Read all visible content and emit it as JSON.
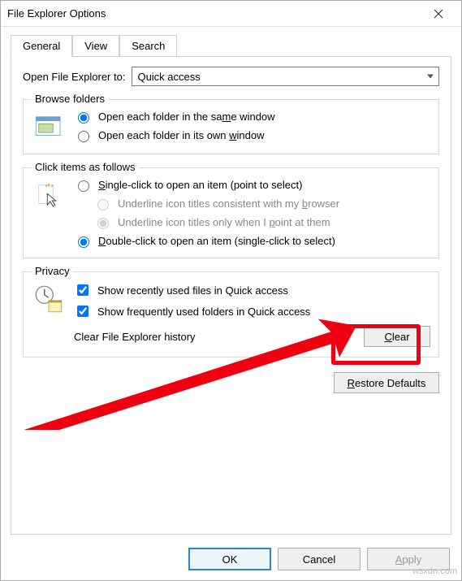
{
  "window": {
    "title": "File Explorer Options"
  },
  "tabs": {
    "general": "General",
    "view": "View",
    "search": "Search"
  },
  "open_to": {
    "label": "Open File Explorer to:",
    "value": "Quick access"
  },
  "browse_folders": {
    "title": "Browse folders",
    "same_window": "Open each folder in the same window",
    "own_window": "Open each folder in its own window"
  },
  "click_items": {
    "title": "Click items as follows",
    "single_click": "Single-click to open an item (point to select)",
    "underline_browser": "Underline icon titles consistent with my browser",
    "underline_point": "Underline icon titles only when I point at them",
    "double_click": "Double-click to open an item (single-click to select)"
  },
  "privacy": {
    "title": "Privacy",
    "show_recent": "Show recently used files in Quick access",
    "show_frequent": "Show frequently used folders in Quick access",
    "clear_label": "Clear File Explorer history",
    "clear_button": "Clear"
  },
  "restore_defaults": "Restore Defaults",
  "buttons": {
    "ok": "OK",
    "cancel": "Cancel",
    "apply": "Apply"
  },
  "watermark": "wsxdn.com"
}
